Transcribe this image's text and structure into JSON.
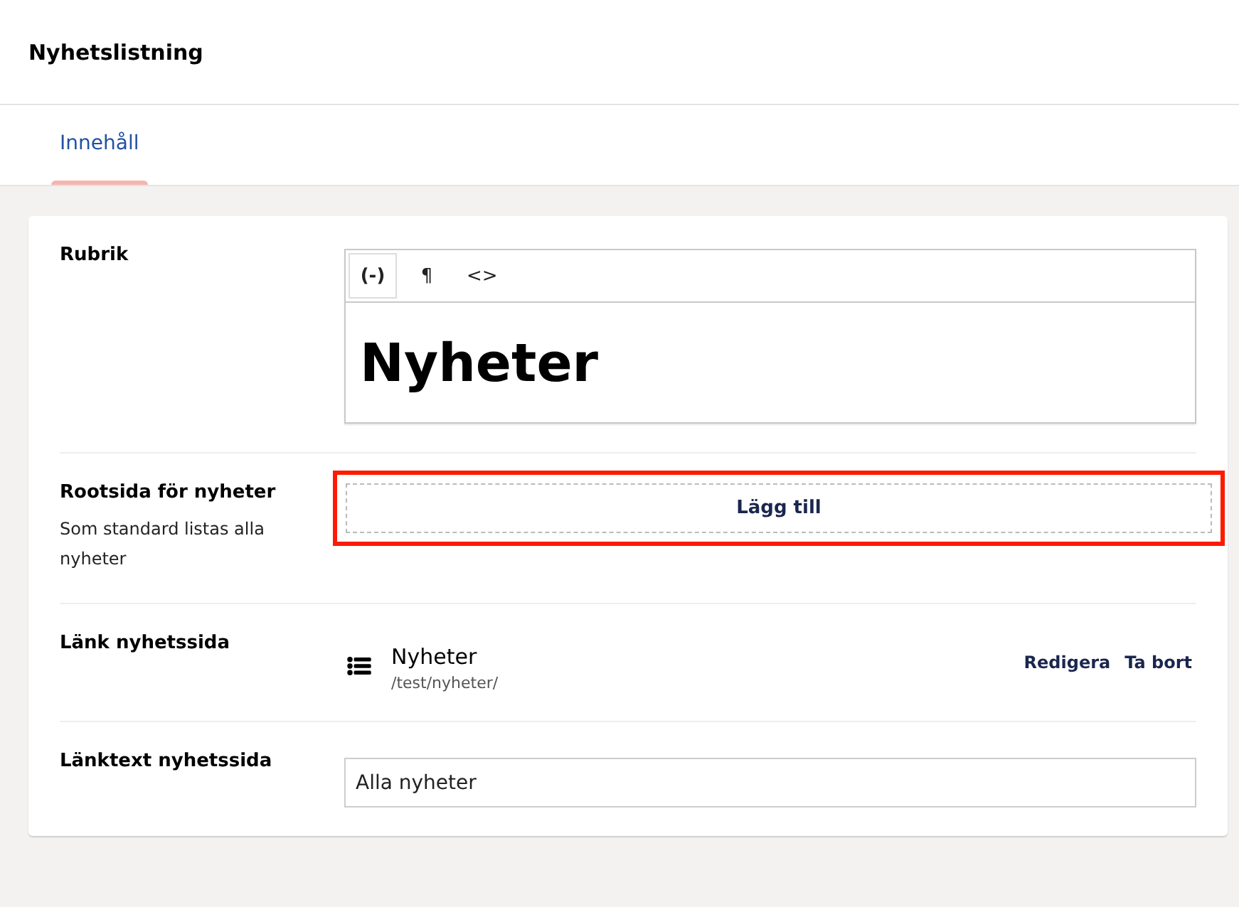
{
  "header": {
    "title": "Nyhetslistning"
  },
  "tabs": [
    {
      "label": "Innehåll",
      "selected": true
    }
  ],
  "properties": [
    {
      "kind": "richtext",
      "label": "Rubrik",
      "toolbar": [
        {
          "label": "(-)",
          "selected": true
        },
        {
          "label": "¶",
          "selected": false
        },
        {
          "label": "<>",
          "selected": false
        }
      ],
      "value": "Nyheter"
    },
    {
      "kind": "picker",
      "label": "Rootsida för nyheter",
      "description": "Som standard listas alla nyheter",
      "button": "Lägg till",
      "highlighted": true
    },
    {
      "kind": "link",
      "label": "Länk nyhetssida",
      "name": "Nyheter",
      "url": "/test/nyheter/",
      "actions": [
        "Redigera",
        "Ta bort"
      ]
    },
    {
      "kind": "text",
      "label": "Länktext nyhetssida",
      "value": "Alla nyheter"
    }
  ]
}
